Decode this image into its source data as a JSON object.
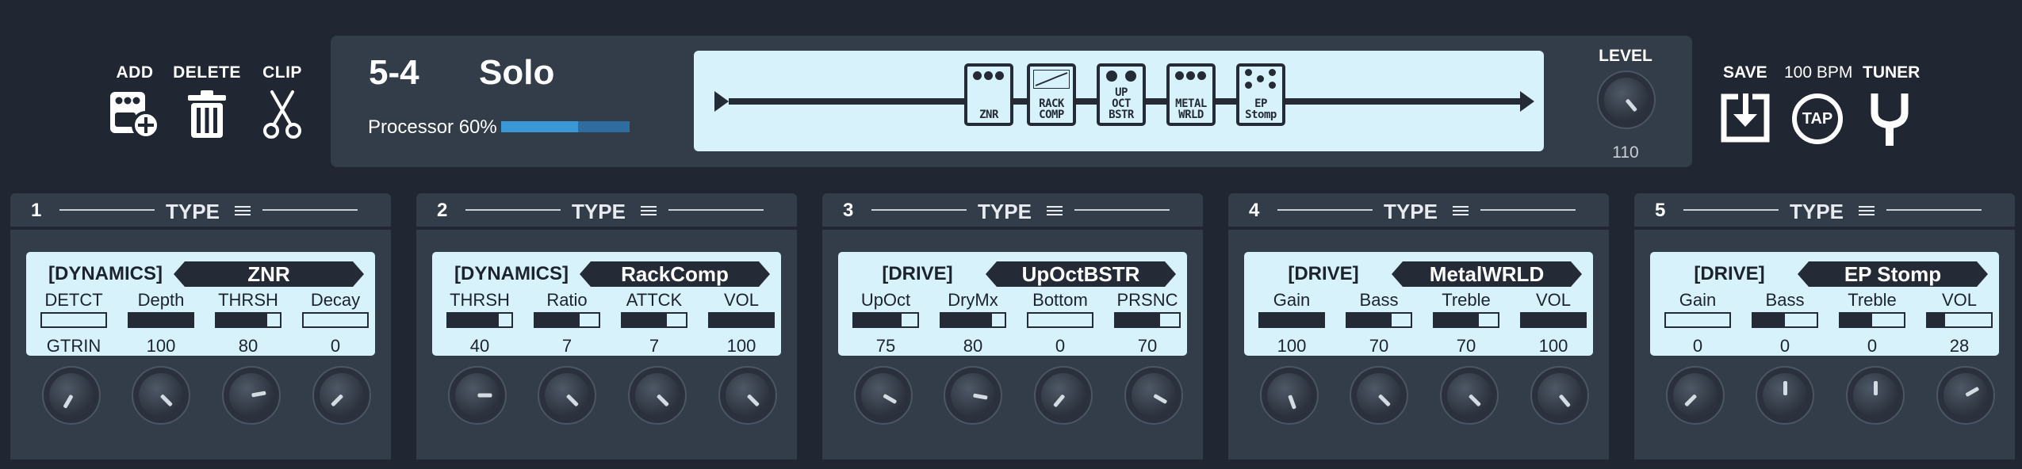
{
  "toolbar_left": {
    "add_label": "ADD",
    "delete_label": "DELETE",
    "clip_label": "CLIP"
  },
  "preset": {
    "number": "5-4",
    "name": "Solo",
    "processor_label": "Processor 60%",
    "processor_load": 0.6
  },
  "chain": {
    "pedals": [
      {
        "label": "ZNR",
        "icon": "three-dot-pedal-icon"
      },
      {
        "label": "RACK COMP",
        "icon": "rack-comp-pedal-icon"
      },
      {
        "label": "UP OCT BSTR",
        "icon": "two-knob-pedal-icon"
      },
      {
        "label": "METAL WRLD",
        "icon": "three-dot-pedal-icon"
      },
      {
        "label": "EP Stomp",
        "icon": "diamond-dot-pedal-icon"
      }
    ]
  },
  "level": {
    "label": "LEVEL",
    "value": "110"
  },
  "toolbar_right": {
    "save_label": "SAVE",
    "bpm_label": "100 BPM",
    "tap_label": "TAP",
    "tuner_label": "TUNER"
  },
  "colors": {
    "background": "#202732",
    "panel": "#333c49",
    "screen": "#d8f2fb",
    "accent": "#3a98d6"
  },
  "units": [
    {
      "number": "1",
      "type_label": "TYPE",
      "category": "[DYNAMICS]",
      "name": "ZNR",
      "params": [
        {
          "name": "DETCT",
          "value": "GTRIN",
          "fill": 0.0
        },
        {
          "name": "Depth",
          "value": "100",
          "fill": 1.0
        },
        {
          "name": "THRSH",
          "value": "80",
          "fill": 0.8
        },
        {
          "name": "Decay",
          "value": "0",
          "fill": 0.0
        }
      ]
    },
    {
      "number": "2",
      "type_label": "TYPE",
      "category": "[DYNAMICS]",
      "name": "RackComp",
      "params": [
        {
          "name": "THRSH",
          "value": "40",
          "fill": 0.8
        },
        {
          "name": "Ratio",
          "value": "7",
          "fill": 0.7
        },
        {
          "name": "ATTCK",
          "value": "7",
          "fill": 0.7
        },
        {
          "name": "VOL",
          "value": "100",
          "fill": 1.0
        }
      ]
    },
    {
      "number": "3",
      "type_label": "TYPE",
      "category": "[DRIVE]",
      "name": "UpOctBSTR",
      "params": [
        {
          "name": "UpOct",
          "value": "75",
          "fill": 0.75
        },
        {
          "name": "DryMx",
          "value": "80",
          "fill": 0.8
        },
        {
          "name": "Bottom",
          "value": "0",
          "fill": 0.0
        },
        {
          "name": "PRSNC",
          "value": "70",
          "fill": 0.7
        }
      ]
    },
    {
      "number": "4",
      "type_label": "TYPE",
      "category": "[DRIVE]",
      "name": "MetalWRLD",
      "params": [
        {
          "name": "Gain",
          "value": "100",
          "fill": 1.0
        },
        {
          "name": "Bass",
          "value": "70",
          "fill": 0.7
        },
        {
          "name": "Treble",
          "value": "70",
          "fill": 0.7
        },
        {
          "name": "VOL",
          "value": "100",
          "fill": 1.0
        }
      ]
    },
    {
      "number": "5",
      "type_label": "TYPE",
      "category": "[DRIVE]",
      "name": "EP Stomp",
      "params": [
        {
          "name": "Gain",
          "value": "0",
          "fill": 0.0
        },
        {
          "name": "Bass",
          "value": "0",
          "fill": 0.5
        },
        {
          "name": "Treble",
          "value": "0",
          "fill": 0.5
        },
        {
          "name": "VOL",
          "value": "28",
          "fill": 0.28
        }
      ]
    }
  ]
}
